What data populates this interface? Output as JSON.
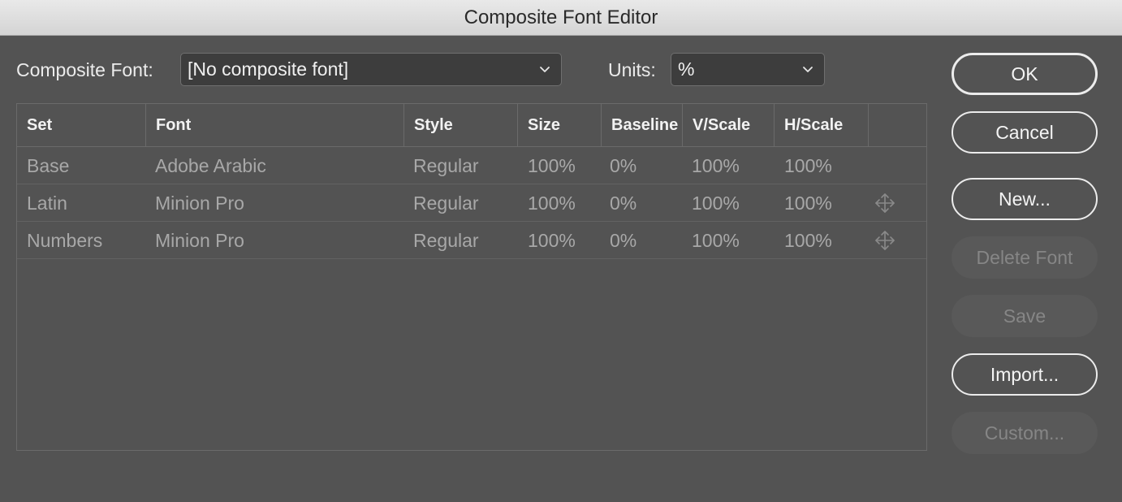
{
  "window": {
    "title": "Composite Font Editor"
  },
  "composite_font": {
    "label": "Composite Font:",
    "value": "[No composite font]"
  },
  "units": {
    "label": "Units:",
    "value": "%"
  },
  "table": {
    "headers": [
      "Set",
      "Font",
      "Style",
      "Size",
      "Baseline",
      "V/Scale",
      "H/Scale"
    ],
    "rows": [
      {
        "set": "Base",
        "font": "Adobe Arabic",
        "style": "Regular",
        "size": "100%",
        "baseline": "0%",
        "vscale": "100%",
        "hscale": "100%",
        "movable": false
      },
      {
        "set": "Latin",
        "font": "Minion Pro",
        "style": "Regular",
        "size": "100%",
        "baseline": "0%",
        "vscale": "100%",
        "hscale": "100%",
        "movable": true
      },
      {
        "set": "Numbers",
        "font": "Minion Pro",
        "style": "Regular",
        "size": "100%",
        "baseline": "0%",
        "vscale": "100%",
        "hscale": "100%",
        "movable": true
      }
    ]
  },
  "buttons": {
    "ok": "OK",
    "cancel": "Cancel",
    "new": "New...",
    "delete_font": "Delete Font",
    "save": "Save",
    "import": "Import...",
    "custom": "Custom..."
  },
  "colors": {
    "background": "#535353",
    "field": "#3d3d3d",
    "disabled_text": "#868686",
    "cell_text": "#a8a8a8"
  }
}
